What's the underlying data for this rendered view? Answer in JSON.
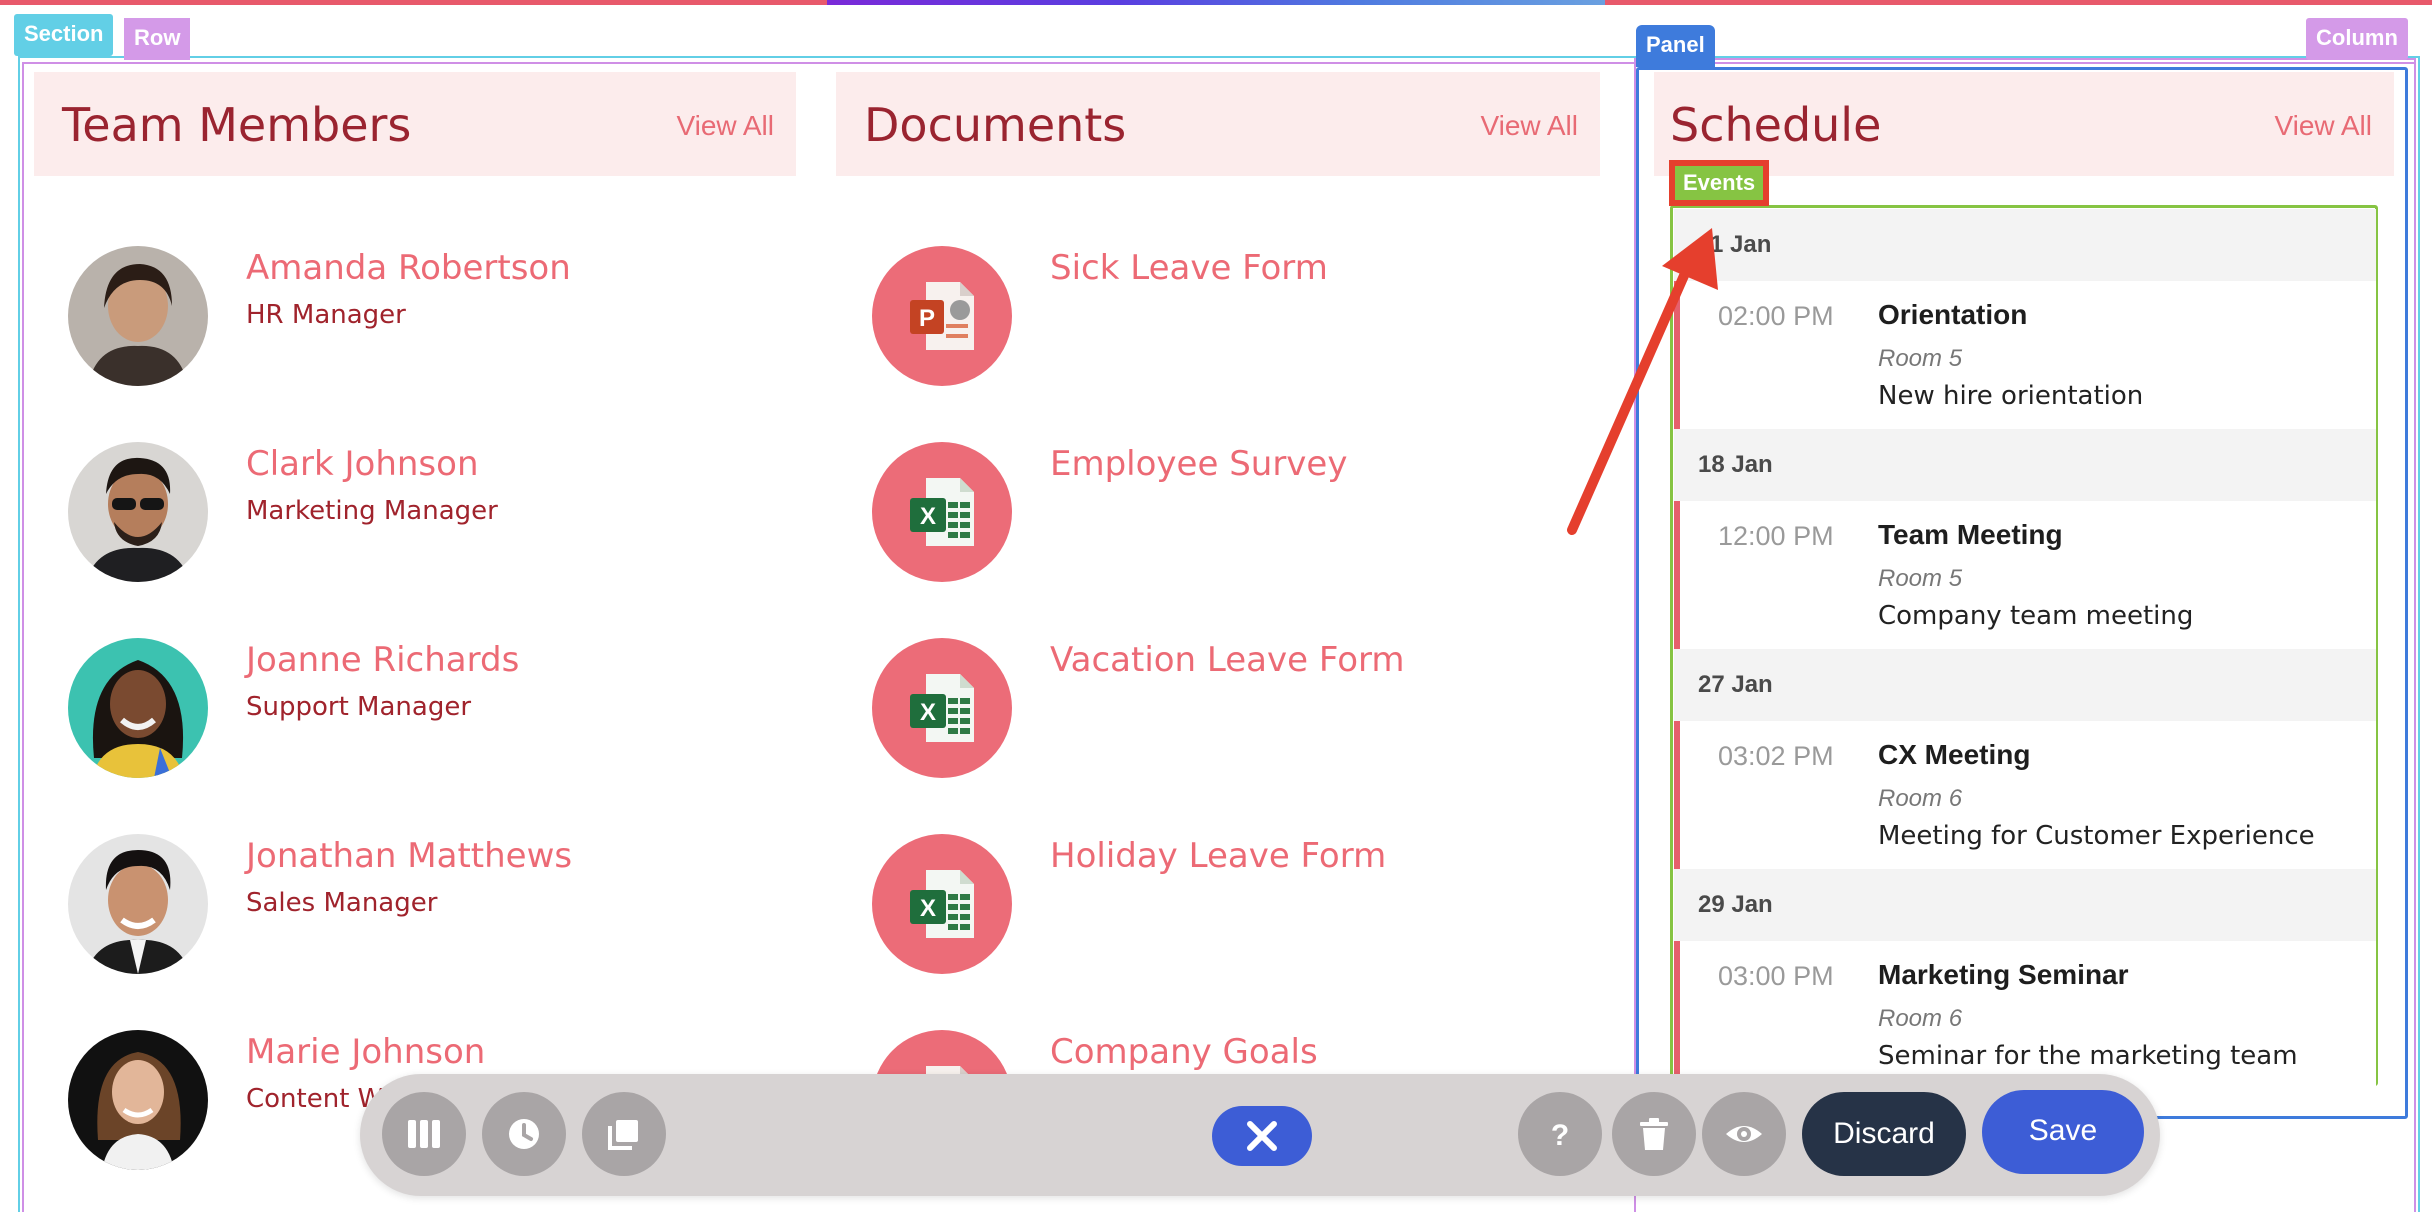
{
  "builder": {
    "section_tag": "Section",
    "row_tag": "Row",
    "panel_tag": "Panel",
    "column_tag": "Column",
    "events_tag": "Events"
  },
  "team": {
    "title": "Team Members",
    "view_all": "View All",
    "members": [
      {
        "name": "Amanda Robertson",
        "role": "HR Manager"
      },
      {
        "name": "Clark Johnson",
        "role": "Marketing Manager"
      },
      {
        "name": "Joanne Richards",
        "role": "Support Manager"
      },
      {
        "name": "Jonathan Matthews",
        "role": "Sales Manager"
      },
      {
        "name": "Marie Johnson",
        "role": "Content W"
      }
    ]
  },
  "documents": {
    "title": "Documents",
    "view_all": "View All",
    "items": [
      {
        "name": "Sick Leave Form",
        "icon": "powerpoint-file-icon"
      },
      {
        "name": "Employee Survey",
        "icon": "excel-file-icon"
      },
      {
        "name": "Vacation Leave Form",
        "icon": "excel-file-icon"
      },
      {
        "name": "Holiday Leave Form",
        "icon": "excel-file-icon"
      },
      {
        "name": "Company Goals",
        "icon": "powerpoint-file-icon"
      }
    ]
  },
  "schedule": {
    "title": "Schedule",
    "view_all": "View All",
    "groups": [
      {
        "date": "11 Jan",
        "time": "02:00 PM",
        "title": "Orientation",
        "room": "Room 5",
        "desc": "New hire orientation"
      },
      {
        "date": "18 Jan",
        "time": "12:00 PM",
        "title": "Team Meeting",
        "room": "Room 5",
        "desc": "Company team meeting"
      },
      {
        "date": "27 Jan",
        "time": "03:02 PM",
        "title": "CX Meeting",
        "room": "Room 6",
        "desc": "Meeting for Customer Experience"
      },
      {
        "date": "29 Jan",
        "time": "03:00 PM",
        "title": "Marketing Seminar",
        "room": "Room 6",
        "desc": "Seminar for the marketing team"
      }
    ]
  },
  "toolbar": {
    "discard_label": "Discard",
    "save_label": "Save",
    "icons": [
      "columns-icon",
      "history-icon",
      "layers-icon",
      "close-icon",
      "help-icon",
      "trash-icon",
      "eye-icon"
    ]
  },
  "colors": {
    "accent_red": "#ec6a75",
    "dark_red": "#9a2430",
    "card_bg": "#fcecec",
    "primary_blue": "#3d5dd6",
    "dark_navy": "#263347",
    "events_green": "#86c443",
    "panel_blue": "#3e7bdc"
  }
}
